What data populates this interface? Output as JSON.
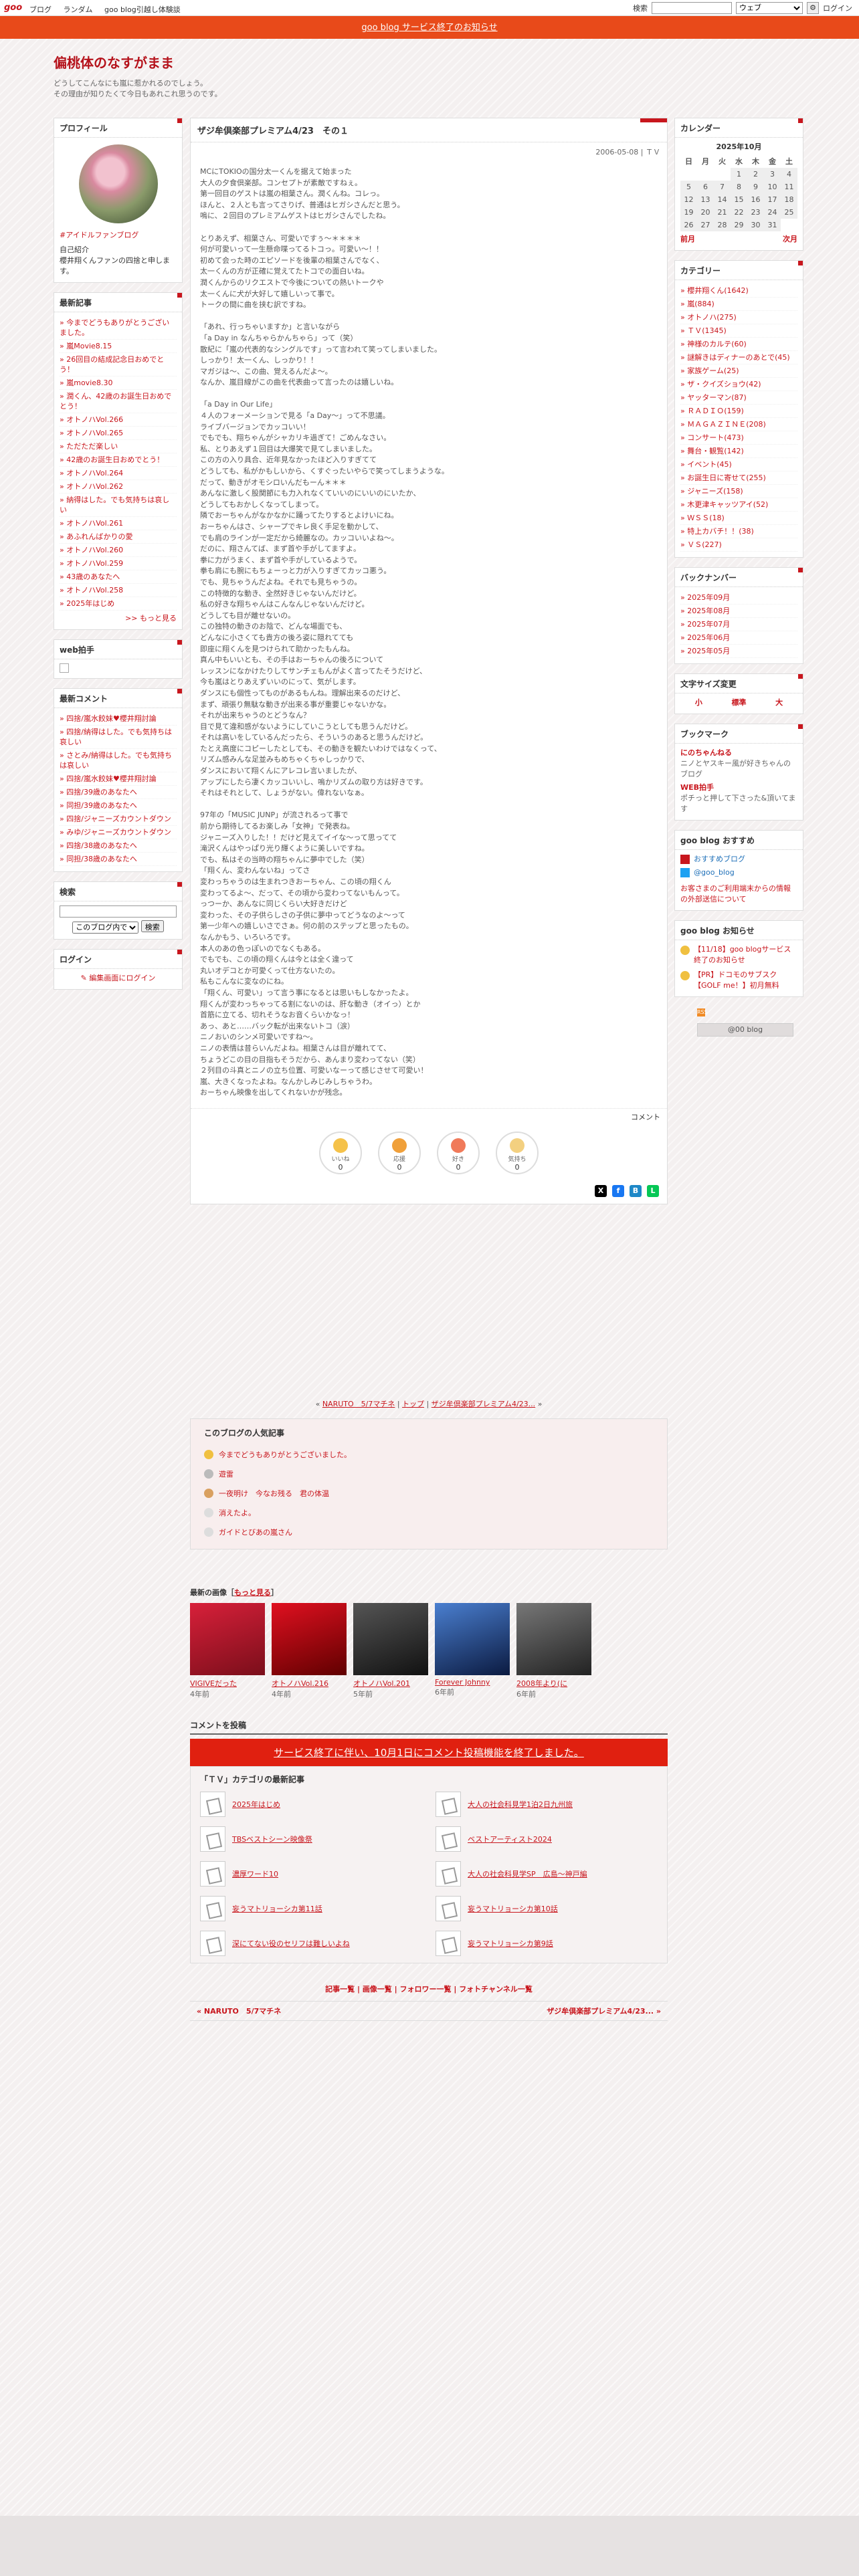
{
  "topbar": {
    "logo": "goo",
    "links": [
      "ブログ",
      "ランダム",
      "goo blog引越し体験談"
    ],
    "search_label": "検索",
    "search_scope": "ウェブ",
    "login": "ログイン"
  },
  "notice": "goo blog サービス終了のお知らせ",
  "header": {
    "title": "偏桃体のなすがまま",
    "desc1": "どうしてこんなにも嵐に惹かれるのでしょう。",
    "desc2": "その理由が知りたくて今日もあれこれ思うのです。"
  },
  "profile": {
    "title": "プロフィール",
    "name": "#アイドルファンブログ",
    "intro_label": "自己紹介",
    "intro": "櫻井翔くんファンの四捨と申します。"
  },
  "recent_posts": {
    "title": "最新記事",
    "items": [
      "今までどうもありがとうございました。",
      "嵐Movie8.15",
      "26回目の結成記念日おめでとう！",
      "嵐movie8.30",
      "潤くん、42歳のお誕生日おめでとう！",
      "オトノハVol.266",
      "オトノハVol.265",
      "ただただ楽しい",
      "42歳のお誕生日おめでとう！",
      "オトノハVol.264",
      "オトノハVol.262",
      "納得はした。でも気持ちは哀しい",
      "オトノハVol.261",
      "あふれんばかりの愛",
      "オトノハVol.260",
      "オトノハVol.259",
      "43歳のあなたへ",
      "オトノハVol.258",
      "2025年はじめ"
    ],
    "more": ">> もっと見る"
  },
  "web_clap": {
    "title": "web拍手"
  },
  "recent_comments": {
    "title": "最新コメント",
    "items": [
      "四捨/嵐水餃妹♥櫻井翔討論",
      "四捨/納得はした。でも気持ちは哀しい",
      "さとみ/納得はした。でも気持ちは哀しい",
      "四捨/嵐水餃妹♥櫻井翔討論",
      "四捨/39歳のあなたへ",
      "同担/39歳のあなたへ",
      "四捨/ジャニーズカウントダウン",
      "みゆ/ジャニーズカウントダウン",
      "四捨/38歳のあなたへ",
      "同担/38歳のあなたへ"
    ]
  },
  "search_box": {
    "title": "検索",
    "scope": "このブログ内で",
    "button": "検索"
  },
  "login_box": {
    "title": "ログイン",
    "link": "編集画面にログイン"
  },
  "calendar": {
    "title": "カレンダー",
    "month": "2025年10月",
    "weekdays": [
      "日",
      "月",
      "火",
      "水",
      "木",
      "金",
      "土"
    ],
    "rows": [
      [
        "",
        "",
        "",
        "1",
        "2",
        "3",
        "4"
      ],
      [
        "5",
        "6",
        "7",
        "8",
        "9",
        "10",
        "11"
      ],
      [
        "12",
        "13",
        "14",
        "15",
        "16",
        "17",
        "18"
      ],
      [
        "19",
        "20",
        "21",
        "22",
        "23",
        "24",
        "25"
      ],
      [
        "26",
        "27",
        "28",
        "29",
        "30",
        "31",
        ""
      ]
    ],
    "prev": "前月",
    "next": "次月"
  },
  "categories": {
    "title": "カテゴリー",
    "items": [
      "櫻井翔くん(1642)",
      "嵐(884)",
      "オトノハ(275)",
      "ＴＶ(1345)",
      "神様のカルテ(60)",
      "謎解きはディナーのあとで(45)",
      "家族ゲーム(25)",
      "ザ・クイズショウ(42)",
      "ヤッターマン(87)",
      "ＲＡＤＩＯ(159)",
      "ＭＡＧＡＺＩＮＥ(208)",
      "コンサート(473)",
      "舞台・観覧(142)",
      "イベント(45)",
      "お誕生日に寄せて(255)",
      "ジャニーズ(158)",
      "木更津キャッツアイ(52)",
      "ＷＳＳ(18)",
      "特上カバチ！！(38)",
      "ＶＳ(227)"
    ]
  },
  "backnumber": {
    "title": "バックナンバー",
    "items": [
      "2025年09月",
      "2025年08月",
      "2025年07月",
      "2025年06月",
      "2025年05月"
    ]
  },
  "fontsize": {
    "title": "文字サイズ変更",
    "small": "小",
    "normal": "標準",
    "large": "大"
  },
  "bookmarks": {
    "title": "ブックマーク",
    "items": [
      {
        "name": "にのちゃんねる",
        "desc": "ニノとヤスキー風が好きちゃんのブログ"
      },
      {
        "name": "WEB拍手",
        "desc": "ポチっと押して下さった&頂いてます"
      }
    ]
  },
  "goo_recommend": {
    "title": "goo blog おすすめ",
    "items": [
      "おすすめブログ",
      "@goo_blog"
    ],
    "note": "お客さまのご利用端末からの情報の外部送信について"
  },
  "goo_info": {
    "title": "goo blog お知らせ",
    "items": [
      "【11/18】goo blogサービス終了のお知らせ",
      "【PR】ドコモのサブスク【GOLF me！】初月無料"
    ]
  },
  "rss_label": "RSS",
  "goo_badge": "@00 blog",
  "article": {
    "title": "ザジ牟倶楽部プレミアム4/23　その１",
    "meta": "2006-05-08 | ＴＶ",
    "body": "MCにTOKIOの国分太一くんを据えて始まった\n大人の夕食倶楽部。コンセプトが素敵ですねぇ。\n第一回目のゲストは嵐の相葉さん。潤くんね。コレっ。\nほんと、２人とも言ってさりげ、普通はヒガシさんだと思う。\n嗚に、２回目のプレミアムゲストはヒガシさんでしたね。\n\nとりあえず、相葉さん、可愛いですぅ〜＊＊＊＊\n何が可愛いって一生懸命喋ってるトコっ。可愛い〜！！\n初めて会った時のエピソードを後輩の相葉さんでなく、\n太一くんの方が正確に覚えてたトコでの面白いね。\n潤くんからのリクエストで今後についての熱いトークや\n太一くんに犬が大好して嬉しいって事で。\nトークの間に曲を挟む訳ですね。\n\n「あれ、行っちゃいますか」と言いながら\n「a Day in なんちゃらかんちゃら」って（笑）\n散紀に「嵐の代表的なシングルです」って言われて笑ってしまいました。\nしっかり！太一くん、しっかり！！\nマガジは〜、この曲、覚えるんだよ〜。\nなんか、嵐目線がこの曲を代表曲って言ったのは嬉しいね。\n\n「a Day in Our Life」\n４人のフォーメーションで見る「a Day〜」って不思議。\nライブバージョンでカッコいい！\nでもでも、翔ちゃんがシャカリキ過ぎて！ごめんなさい。\n私、とりあえず１回目は大爆笑で見てしまいました。\nこの方の入り具合、近年見なかったほど入りすぎてて\nどうしても、私がかもしいから、くすぐったいやらで笑ってしまうような。\nだって、動きがオモシロいんだもーん＊＊＊\nあんなに激しく股関節にも力入れなくていいのにいいのにいたか、\nどうしてもおかしくなってしまって。\n隣でおーちゃんがなかなかに踊ってたりするとよけいにね。\nおーちゃんはさ、シャープでキレ良く手足を動かして、\nでも肩のラインが一定だから綺麗なの。カッコいいよね〜。\nだのに、翔さんてば、まず首や手がしてますよ。\n拳に力がうまく、まず首や手がしているようで。\n拳も肩にも腕にもちょーっと力が入りすぎてカッコ悪う。\nでも、見ちゃうんだよね。それでも見ちゃうの。\nこの特徴的な動き、全然好きじゃないんだけど。\n私の好きな翔ちゃんはこんなんじゃないんだけど。\nどうしても目が離せないの。\nこの独特の動きのお陰で、どんな場面でも、\nどんなに小さくても貴方の後ろ姿に隠れてても\n即座に翔くんを見つけられて助かったもんね。\n真ん中もいいとも、その手はおーちゃんの後ろについて\nレッスンになかけたりしてサンチェもんがよく言ってたそうだけど、\n今も嵐はとりあえずいいのにって、気がします。\nダンスにも個性ってものがあるもんね。理解出来るのだけど、\nまず、頑張り無駄な動きが出来る事が重要じゃないかな。\nそれが出来ちゃうのとどうなん？\n目で見て違和感がないようにしていこうとしても思うんだけど。\nそれは高いをしているんだったら、そういうのあると思うんだけど。\nたとえ高度にコピーしたとしても、その動きを観たいわけではなくって、\nリズム感みんな足並みもめちゃくちゃしっかりで、\nダンスにおいて翔くんにアレコレ言いましたが、\nアップにしたら凄くカッコいいし、嗚かリズムの取り方は好きです。\nそれはそれとして、しょうがない。偉れないなぁ。\n\n97年の「MUSIC JUNP」が流されるって事で\n前から期待してるお楽しみ「女神」で発表ね。\nジャニーズ入りした！！だけど見えてイイな〜って思ってて\n滝沢くんはやっぱり光り輝くように美しいですね。\nでも、私はその当時の翔ちゃんに夢中でした（笑）\n「翔くん、変わんないね」ってさ\n変わっちゃうのは生まれつきおーちゃん、この頃の翔くん\n変わってるよ〜、だって、その頃から変わってないもんって。\nっつーか、あんなに同じくらい大好きだけど\n変わった、その子供らしさの子供に夢中ってどうなのよ〜って\n第一少年への嬉しいさでさぁ。何の前のステップと思ったもの。\nなんかもう、いろいろです。\n本人のあの色っぽいのでなくもある。\nでもでも、この頃の翔くんは今とは全く違って\n丸いオデコとか可愛くって仕方ないたの。\n私もこんなに変なのにね。\n「翔くん、可愛い」って言う事になるとは思いもしなかったよ。\n翔くんが変わっちゃってる割にないのは、肝な動き（オイっ）とか\n首筋に立てる、切れそうなお音くらいかなっ！\nあっ、あと……バック転が出来ないトコ（涙）\nニノおいのシンメ可愛いですね〜。\nニノの表情は昔らいんだよね。相葉さんは目が離れてて、\nちょうどこの目の目指もそうだから、あんまり変わってない（笑）\n２列目の斗真とニノの立ち位置、可愛いなーって感じさせて可愛い！\n嵐、大きくなったよね。なんかしみじみしちゃうわ。\nおーちゃん映像を出してくれないかが残念。",
    "comment_link": "コメント"
  },
  "reactions": [
    {
      "label": "いいね",
      "count": "0",
      "color": "#f5c24a"
    },
    {
      "label": "応援",
      "count": "0",
      "color": "#f0a03a"
    },
    {
      "label": "好き",
      "count": "0",
      "color": "#f07a5a"
    },
    {
      "label": "気持ち",
      "count": "0",
      "color": "#f3d080"
    }
  ],
  "nav_line": {
    "prev": "NARUTO　5/7マチネ",
    "top": "トップ",
    "next": "ザジ牟倶楽部プレミアム4/23..."
  },
  "popular": {
    "title": "このブログの人気記事",
    "items": [
      "今までどうもありがとうございました。",
      "遊雷",
      "一夜明け　今なお残る　君の体温",
      "消えたよ。",
      "ガイドとびあの嵐さん"
    ]
  },
  "recent_images": {
    "title": "最新の画像",
    "more": "もっと見る",
    "items": [
      {
        "title": "VIGIVEだった",
        "age": "4年前"
      },
      {
        "title": "オトノハVol.216",
        "age": "4年前"
      },
      {
        "title": "オトノハVol.201",
        "age": "5年前"
      },
      {
        "title": "Forever Johnny",
        "age": "6年前"
      },
      {
        "title": "2008年より(に",
        "age": "6年前"
      }
    ]
  },
  "post_comment": {
    "title": "コメントを投稿",
    "closed": "サービス終了に伴い、10月1日にコメント投稿機能を終了しました。"
  },
  "category_latest": {
    "title": "「ＴＶ」カテゴリの最新記事",
    "items": [
      "2025年はじめ",
      "大人の社会科見学1泊2日九州旅",
      "TBSベストシーン映像祭",
      "ベストアーティスト2024",
      "濃厚ワード10",
      "大人の社会科見学SP　広島〜神戸編",
      "妄うマトリョーシカ第11話",
      "妄うマトリョーシカ第10話",
      "深にてない役のセリフは難しいよね",
      "妄うマトリョーシカ第9話"
    ]
  },
  "footer_nav": [
    "記事一覧",
    "画像一覧",
    "フォロワー一覧",
    "フォトチャンネル一覧"
  ],
  "prevnext": {
    "prev": "« NARUTO　5/7マチネ",
    "next": "ザジ牟倶楽部プレミアム4/23... »"
  }
}
